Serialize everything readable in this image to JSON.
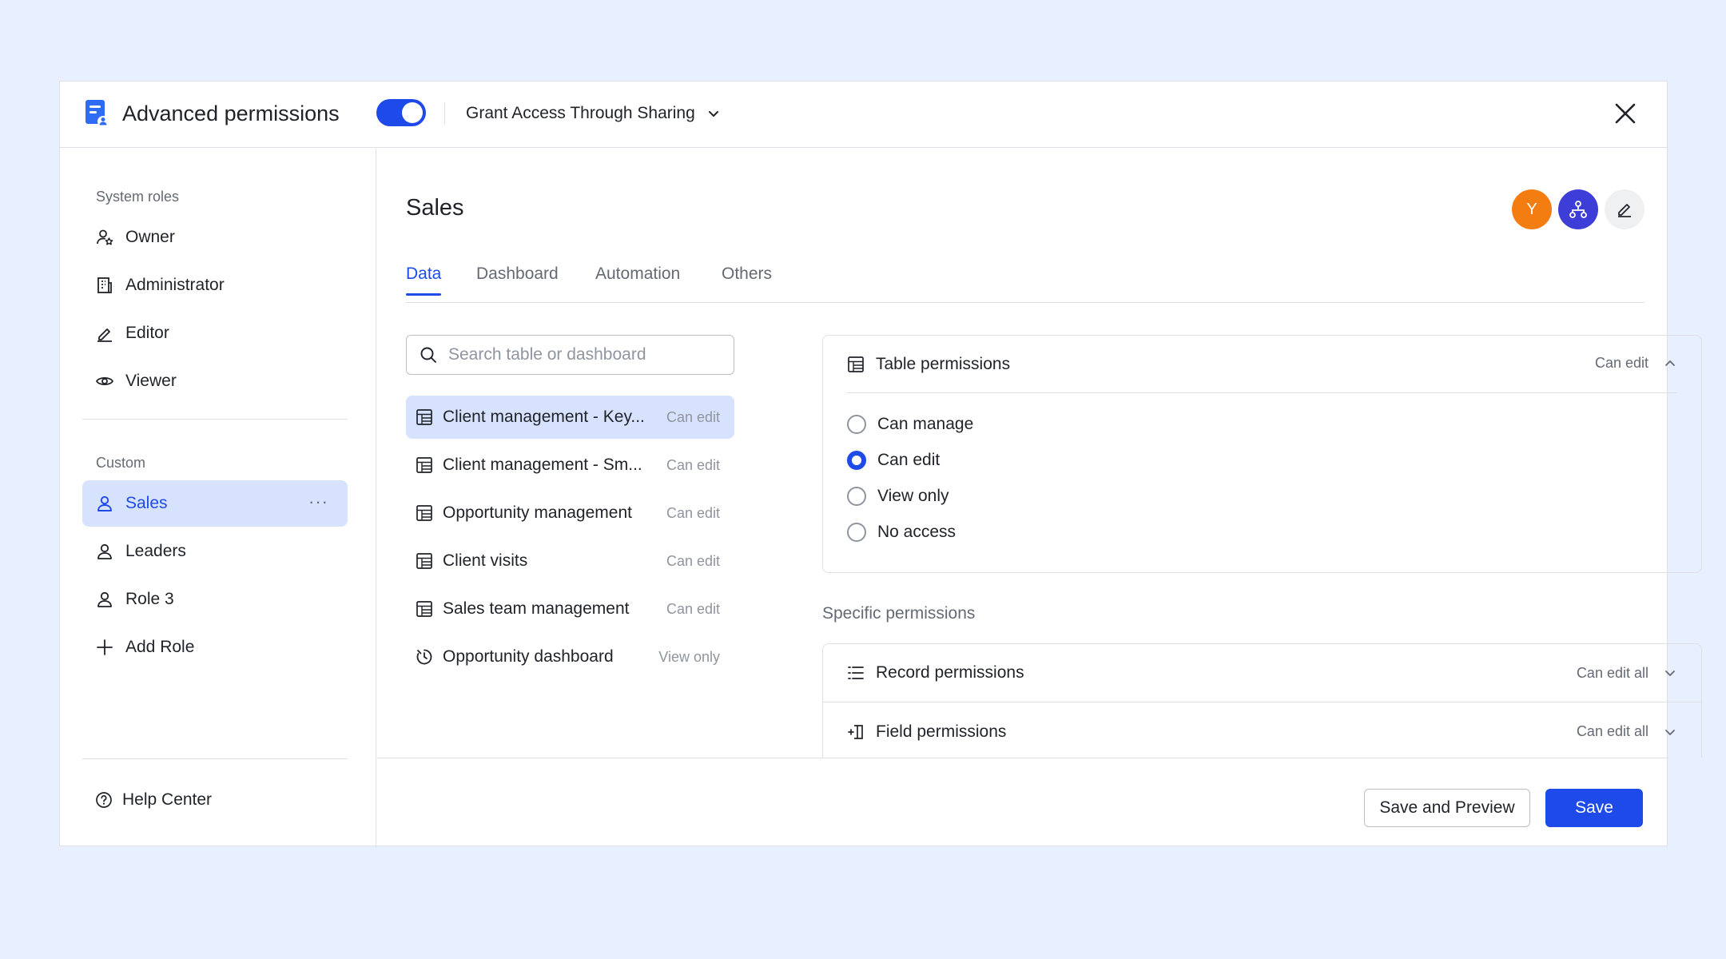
{
  "header": {
    "title": "Advanced permissions",
    "toggle_on": true,
    "access_mode": "Grant Access Through Sharing"
  },
  "sidebar": {
    "system_label": "System roles",
    "system_roles": [
      {
        "label": "Owner",
        "icon": "owner-icon"
      },
      {
        "label": "Administrator",
        "icon": "building-icon"
      },
      {
        "label": "Editor",
        "icon": "pencil-icon"
      },
      {
        "label": "Viewer",
        "icon": "eye-icon"
      }
    ],
    "custom_label": "Custom",
    "custom_roles": [
      {
        "label": "Sales",
        "icon": "user-icon",
        "active": true
      },
      {
        "label": "Leaders",
        "icon": "user-icon"
      },
      {
        "label": "Role 3",
        "icon": "user-icon"
      }
    ],
    "add_role": "Add Role",
    "more": "···",
    "help": "Help Center"
  },
  "main": {
    "title": "Sales",
    "avatar_initial": "Y",
    "tabs": [
      "Data",
      "Dashboard",
      "Automation",
      "Others"
    ],
    "active_tab": "Data",
    "search_placeholder": "Search table or dashboard",
    "tables": [
      {
        "name": "Client management - Key...",
        "perm": "Can edit",
        "icon": "table-icon",
        "active": true
      },
      {
        "name": "Client management - Sm...",
        "perm": "Can edit",
        "icon": "table-icon"
      },
      {
        "name": "Opportunity management",
        "perm": "Can edit",
        "icon": "table-icon"
      },
      {
        "name": "Client visits",
        "perm": "Can edit",
        "icon": "table-icon"
      },
      {
        "name": "Sales team management",
        "perm": "Can edit",
        "icon": "table-icon"
      },
      {
        "name": "Opportunity dashboard",
        "perm": "View only",
        "icon": "dashboard-icon"
      }
    ],
    "table_permissions": {
      "title": "Table permissions",
      "value": "Can edit",
      "options": [
        "Can manage",
        "Can edit",
        "View only",
        "No access"
      ],
      "selected": 1
    },
    "specific_label": "Specific permissions",
    "record_permissions": {
      "title": "Record permissions",
      "value": "Can edit all"
    },
    "field_permissions": {
      "title": "Field permissions",
      "value": "Can edit all"
    }
  },
  "footer": {
    "save_preview": "Save and Preview",
    "save": "Save"
  },
  "colors": {
    "accent": "#1d4ae8",
    "avatar_orange": "#f47d12",
    "avatar_indigo": "#3d3dd8",
    "background": "#e8effe"
  }
}
